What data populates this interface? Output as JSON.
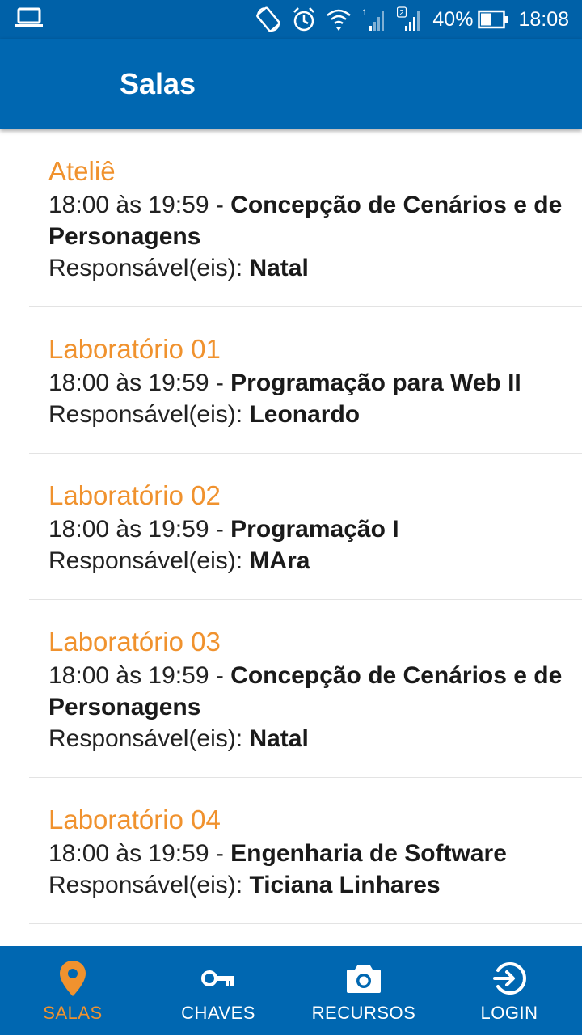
{
  "status_bar": {
    "battery_percent": "40%",
    "time": "18:08",
    "sim1_label": "1",
    "sim2_label": "2",
    "icons": [
      "laptop-icon",
      "screen-rotation-icon",
      "alarm-icon",
      "wifi-icon",
      "signal-icon",
      "battery-icon"
    ]
  },
  "app_bar": {
    "title": "Salas"
  },
  "rooms": [
    {
      "name": "Ateliê",
      "time_range": "18:00 às 19:59 - ",
      "course": "Concepção de Cenários e de Personagens",
      "responsible_label": "Responsável(eis): ",
      "responsible": "Natal"
    },
    {
      "name": "Laboratório 01",
      "time_range": "18:00 às 19:59 - ",
      "course": "Programação para Web II",
      "responsible_label": "Responsável(eis): ",
      "responsible": "Leonardo"
    },
    {
      "name": "Laboratório 02",
      "time_range": "18:00 às 19:59 - ",
      "course": "Programação I",
      "responsible_label": "Responsável(eis): ",
      "responsible": "MAra"
    },
    {
      "name": "Laboratório 03",
      "time_range": "18:00 às 19:59 - ",
      "course": "Concepção de Cenários e de Personagens",
      "responsible_label": "Responsável(eis): ",
      "responsible": "Natal"
    },
    {
      "name": "Laboratório 04",
      "time_range": "18:00 às 19:59 - ",
      "course": "Engenharia de Software",
      "responsible_label": "Responsável(eis): ",
      "responsible": "Ticiana Linhares"
    }
  ],
  "bottom_nav": {
    "items": [
      {
        "label": "SALAS",
        "icon": "location-pin-icon",
        "active": true
      },
      {
        "label": "CHAVES",
        "icon": "key-icon",
        "active": false
      },
      {
        "label": "RECURSOS",
        "icon": "camera-icon",
        "active": false
      },
      {
        "label": "LOGIN",
        "icon": "login-icon",
        "active": false
      }
    ]
  },
  "colors": {
    "primary": "#0067b1",
    "status_bar": "#0061a8",
    "accent": "#f0922e",
    "text": "#222222",
    "divider": "#e3e3e3"
  }
}
